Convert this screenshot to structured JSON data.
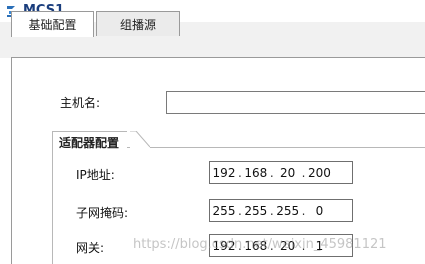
{
  "window": {
    "title": "MCS1",
    "icon": "router-icon"
  },
  "tabs": [
    {
      "label": "基础配置",
      "active": true
    },
    {
      "label": "组播源",
      "active": false
    }
  ],
  "hostname": {
    "label": "主机名:",
    "value": ""
  },
  "adapter": {
    "title": "适配器配置",
    "ip": {
      "label": "IP地址:",
      "octets": [
        "192",
        "168",
        "20",
        "200"
      ]
    },
    "mask": {
      "label": "子网掩码:",
      "octets": [
        "255",
        "255",
        "255",
        "0"
      ]
    },
    "gateway": {
      "label": "网关:",
      "octets": [
        "192",
        "168",
        "20",
        "1"
      ]
    }
  },
  "watermark": "https://blog.csdn.net/weixin_45981121"
}
